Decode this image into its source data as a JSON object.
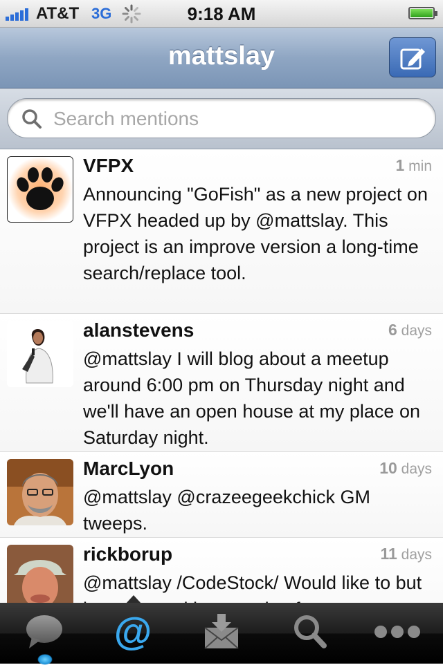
{
  "status_bar": {
    "carrier": "AT&T",
    "network": "3G",
    "time": "9:18 AM"
  },
  "nav": {
    "title": "mattslay",
    "compose_icon": "compose-icon"
  },
  "search": {
    "placeholder": "Search mentions",
    "value": ""
  },
  "tweets": [
    {
      "user": "VFPX",
      "age_num": "1",
      "age_unit": "min",
      "text": "Announcing \"GoFish\" as a new project on VFPX headed up by @mattslay. This project is an improve version a long-time search/replace tool."
    },
    {
      "user": "alanstevens",
      "age_num": "6",
      "age_unit": "days",
      "text": "@mattslay I will blog about a meetup around 6:00 pm on Thursday night and we'll have an open house at my place on Saturday night."
    },
    {
      "user": "MarcLyon",
      "age_num": "10",
      "age_unit": "days",
      "text": "@mattslay @crazeegeekchick GM tweeps."
    },
    {
      "user": "rickborup",
      "age_num": "11",
      "age_unit": "days",
      "text": "@mattslay /CodeStock/ Would like to but it conflicts with a couple of"
    }
  ],
  "tab_bar": {
    "tabs": [
      "speech-bubble-icon",
      "at-sign-icon",
      "inbox-icon",
      "search-icon",
      "more-icon"
    ],
    "selected_index": 1
  },
  "colors": {
    "nav_gradient_top": "#b8c8dc",
    "nav_gradient_bottom": "#7b95b6",
    "accent": "#2b6dd8",
    "selected_tab": "#3aa8ee"
  }
}
